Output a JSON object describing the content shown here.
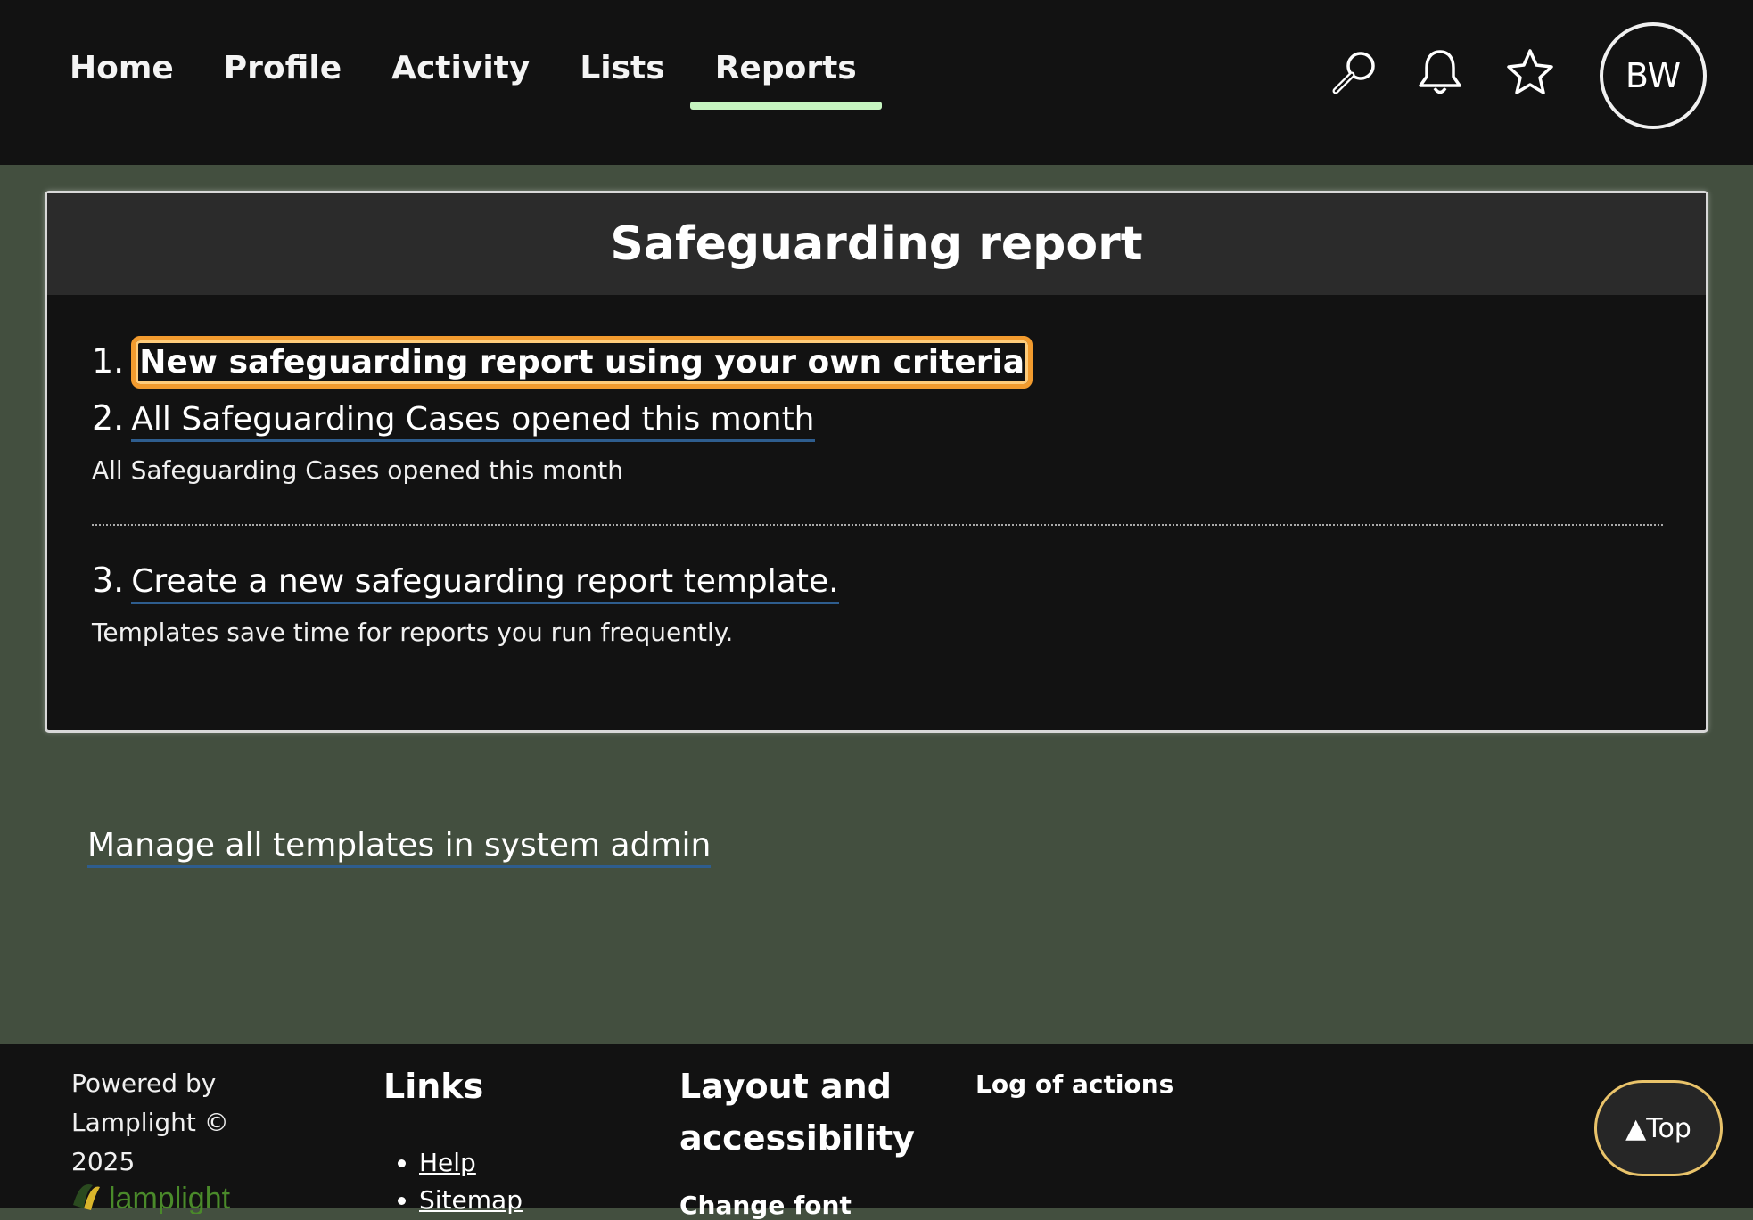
{
  "nav": {
    "items": [
      {
        "label": "Home"
      },
      {
        "label": "Profile"
      },
      {
        "label": "Activity"
      },
      {
        "label": "Lists"
      },
      {
        "label": "Reports"
      }
    ],
    "active": "Reports",
    "avatar_initials": "BW",
    "icons": [
      "search-icon",
      "bell-icon",
      "star-icon"
    ]
  },
  "card": {
    "title": "Safeguarding report",
    "items": [
      {
        "number": "1.",
        "label": "New safeguarding report using your own criteria",
        "description": ""
      },
      {
        "number": "2.",
        "label": "All Safeguarding Cases opened this month",
        "description": "All Safeguarding Cases opened this month"
      },
      {
        "number": "3.",
        "label": "Create a new safeguarding report template.",
        "description": "Templates save time for reports you run frequently."
      }
    ]
  },
  "manage_link": "Manage all templates in system admin",
  "footer": {
    "powered_by": "Powered by Lamplight © 2025",
    "links_heading": "Links",
    "links": [
      "Help",
      "Sitemap"
    ],
    "layout_heading": "Layout and accessibility",
    "change_font": "Change font",
    "log_of_actions": "Log of actions",
    "top_button": "▲Top"
  },
  "colors": {
    "background": "#434f3f",
    "topbar": "#121212",
    "active_underline": "#c6f5c0",
    "focus_outline": "#f29b2e",
    "link_underline": "#2e5d8e",
    "top_button_border": "#e9c36a"
  }
}
